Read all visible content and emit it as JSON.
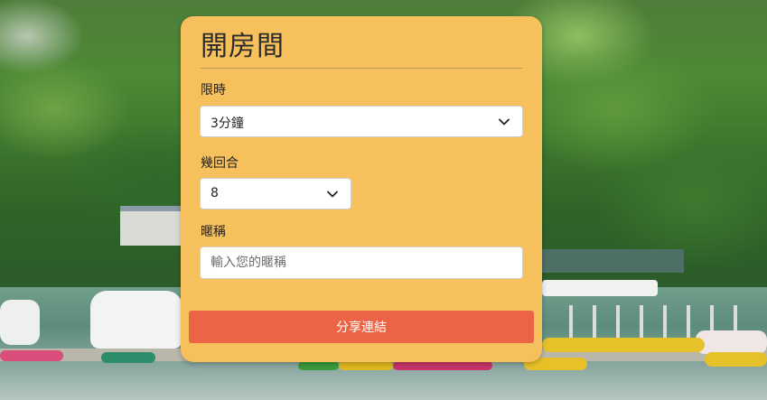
{
  "modal": {
    "title": "開房間",
    "time_limit": {
      "label": "限時",
      "selected": "3分鐘"
    },
    "rounds": {
      "label": "幾回合",
      "selected": "8"
    },
    "nickname": {
      "label": "暱稱",
      "placeholder": "輸入您的暱稱",
      "value": ""
    },
    "share_button_label": "分享連結"
  },
  "colors": {
    "modal_background": "#f6c05c",
    "share_button": "#ec6445",
    "text": "#222222"
  },
  "icons": {
    "select_arrow": "chevron-down-icon"
  }
}
